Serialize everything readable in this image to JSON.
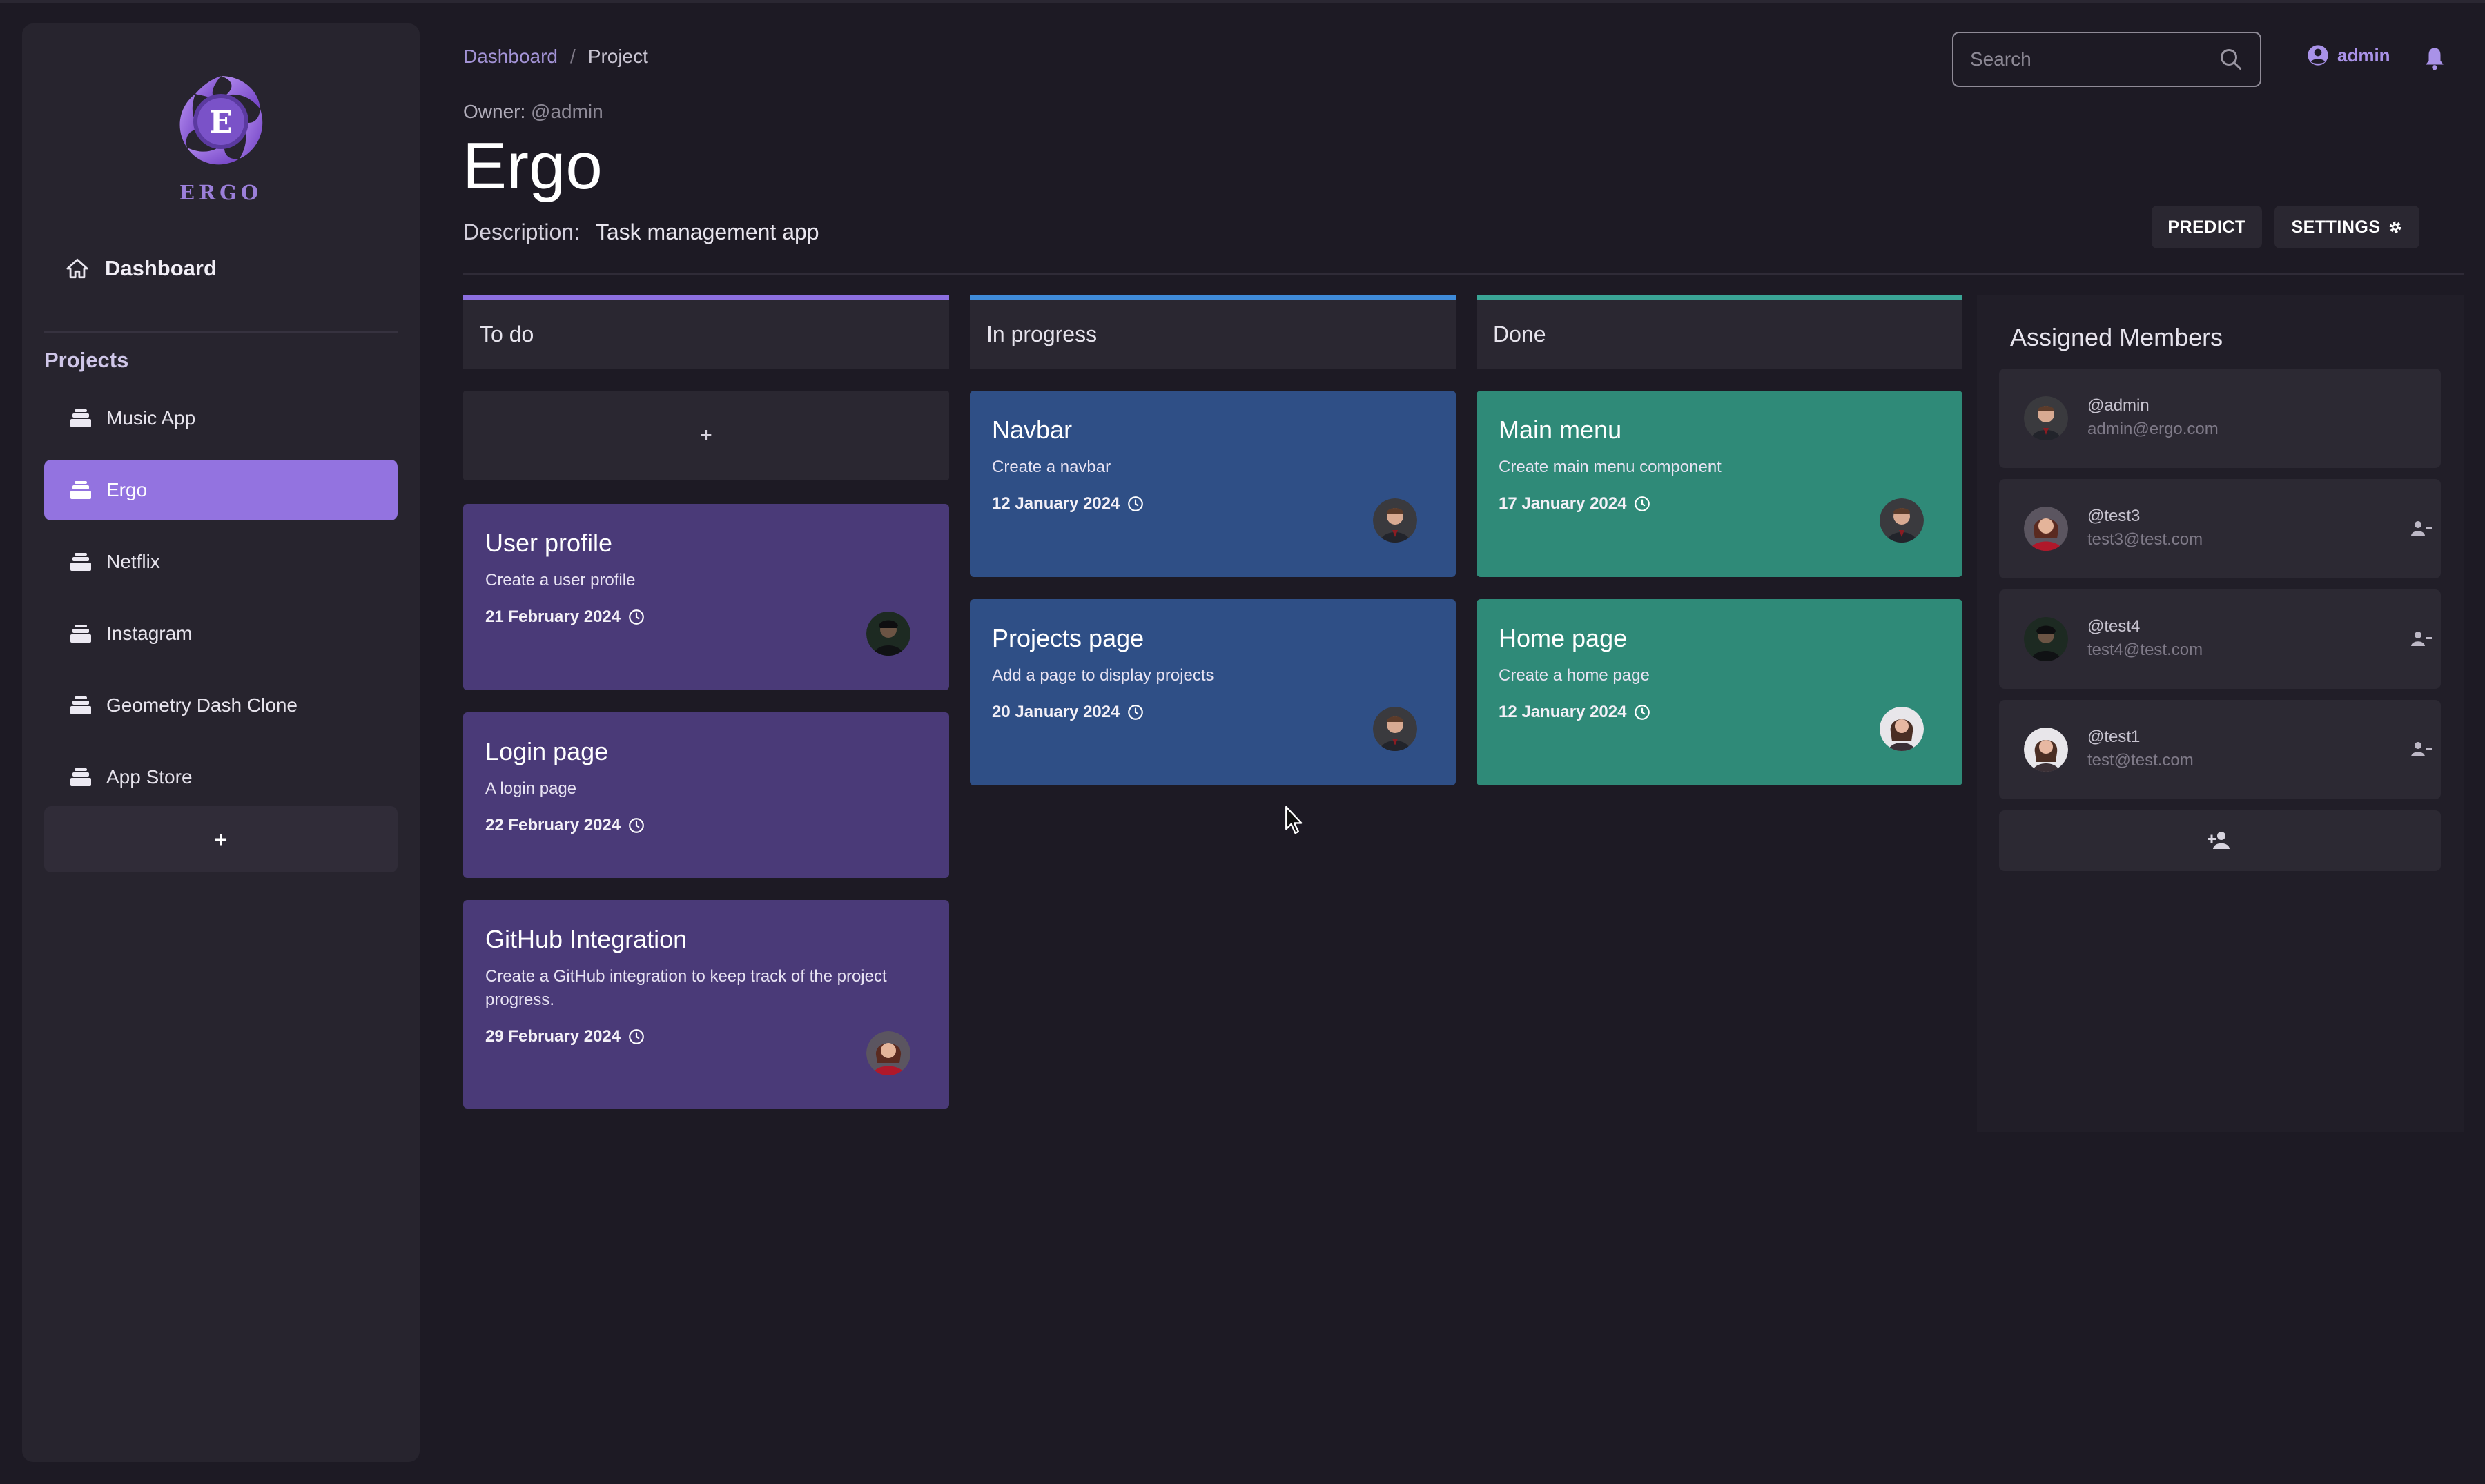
{
  "brand": {
    "logo_letter": "E",
    "logo_text": "ERGO"
  },
  "sidebar": {
    "dashboard_label": "Dashboard",
    "projects_heading": "Projects",
    "projects": [
      {
        "label": "Music App"
      },
      {
        "label": "Ergo",
        "active": true
      },
      {
        "label": "Netflix"
      },
      {
        "label": "Instagram"
      },
      {
        "label": "Geometry Dash Clone"
      },
      {
        "label": "App Store"
      }
    ],
    "add_label": "+"
  },
  "breadcrumb": {
    "link": "Dashboard",
    "separator": "/",
    "current": "Project"
  },
  "header": {
    "owner_label": "Owner:",
    "owner_handle": "@admin",
    "title": "Ergo",
    "description_label": "Description:",
    "description": "Task management app"
  },
  "search": {
    "placeholder": "Search"
  },
  "user": {
    "name": "admin"
  },
  "actions": {
    "predict": "PREDICT",
    "settings": "SETTINGS"
  },
  "board": {
    "columns": [
      {
        "title": "To do",
        "add_label": "+",
        "cards": [
          {
            "title": "User profile",
            "description": "Create a user profile",
            "date": "21 February 2024",
            "avatar": "avatar-dark"
          },
          {
            "title": "Login page",
            "description": "A login page",
            "date": "22 February 2024"
          },
          {
            "title": "GitHub Integration",
            "description": "Create a GitHub integration to keep track of the project progress.",
            "date": "29 February 2024",
            "avatar": "avatar-red"
          }
        ]
      },
      {
        "title": "In progress",
        "cards": [
          {
            "title": "Navbar",
            "description": "Create a navbar",
            "date": "12 January 2024",
            "avatar": "avatar-man"
          },
          {
            "title": "Projects page",
            "description": "Add a page to display projects",
            "date": "20 January 2024",
            "avatar": "avatar-man"
          }
        ]
      },
      {
        "title": "Done",
        "cards": [
          {
            "title": "Main menu",
            "description": "Create main menu component",
            "date": "17 January 2024",
            "avatar": "avatar-man"
          },
          {
            "title": "Home page",
            "description": "Create a home page",
            "date": "12 January 2024",
            "avatar": "avatar-woman"
          }
        ]
      }
    ]
  },
  "members": {
    "title": "Assigned Members",
    "list": [
      {
        "handle": "@admin",
        "email": "admin@ergo.com"
      },
      {
        "handle": "@test3",
        "email": "test3@test.com"
      },
      {
        "handle": "@test4",
        "email": "test4@test.com"
      },
      {
        "handle": "@test1",
        "email": "test@test.com"
      }
    ]
  },
  "colors": {
    "accent": "#9373e0",
    "todo": "#4a3a78",
    "in_progress": "#2f4f86",
    "done": "#2f8a78",
    "background": "#1d1a24",
    "sidebar": "#27242e"
  }
}
